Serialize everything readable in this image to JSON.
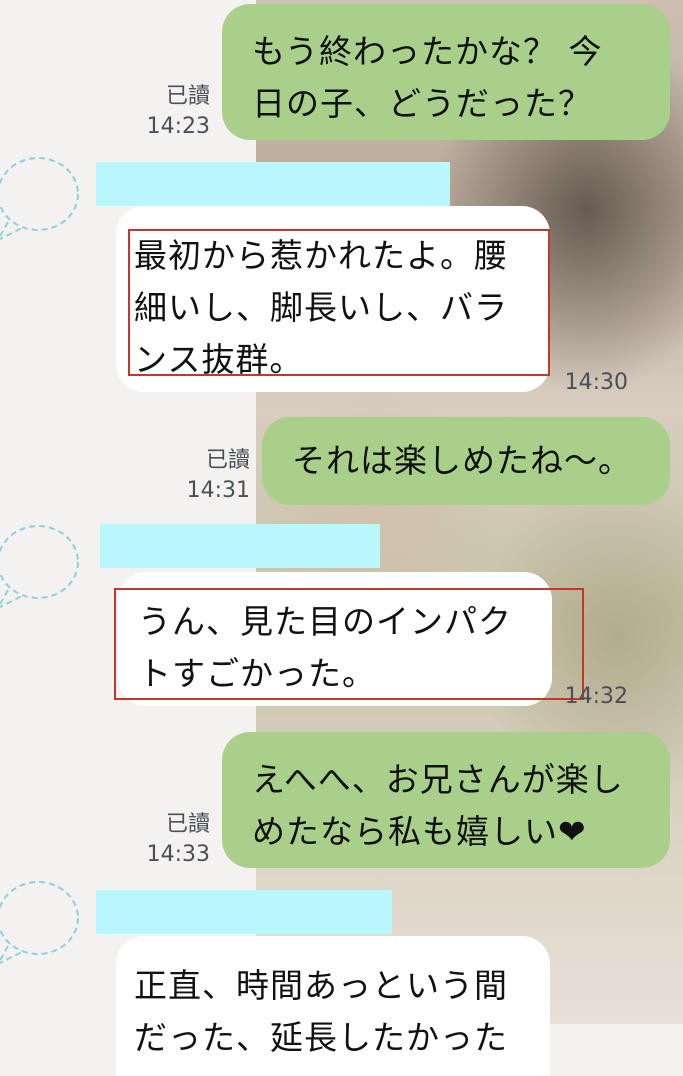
{
  "messages": [
    {
      "id": "m1",
      "direction": "out",
      "lines": [
        "もう終わったかな？ 今",
        "日の子、どうだった？"
      ],
      "read": "已讀",
      "time": "14:23"
    },
    {
      "id": "m2",
      "direction": "in",
      "lines": [
        "最初から惹かれたよ。腰",
        "細いし、脚長いし、バラ",
        "ンス抜群。"
      ],
      "time": "14:30"
    },
    {
      "id": "m3",
      "direction": "out",
      "lines": [
        "それは楽しめたね〜。"
      ],
      "read": "已讀",
      "time": "14:31"
    },
    {
      "id": "m4",
      "direction": "in",
      "lines": [
        "うん、見た目のインパク",
        "トすごかった。"
      ],
      "time": "14:32"
    },
    {
      "id": "m5",
      "direction": "out",
      "lines": [
        "えへへ、お兄さんが楽し",
        "めたなら私も嬉しい❤"
      ],
      "read": "已讀",
      "time": "14:33"
    },
    {
      "id": "m6",
      "direction": "in",
      "lines": [
        "正直、時間あっという間",
        "だった、延長したかった"
      ]
    }
  ],
  "colors": {
    "outgoing_bubble": "#a8d08a",
    "incoming_bubble": "#ffffff",
    "name_bar": "#b8f7fb",
    "highlight_border": "#c0392b"
  }
}
